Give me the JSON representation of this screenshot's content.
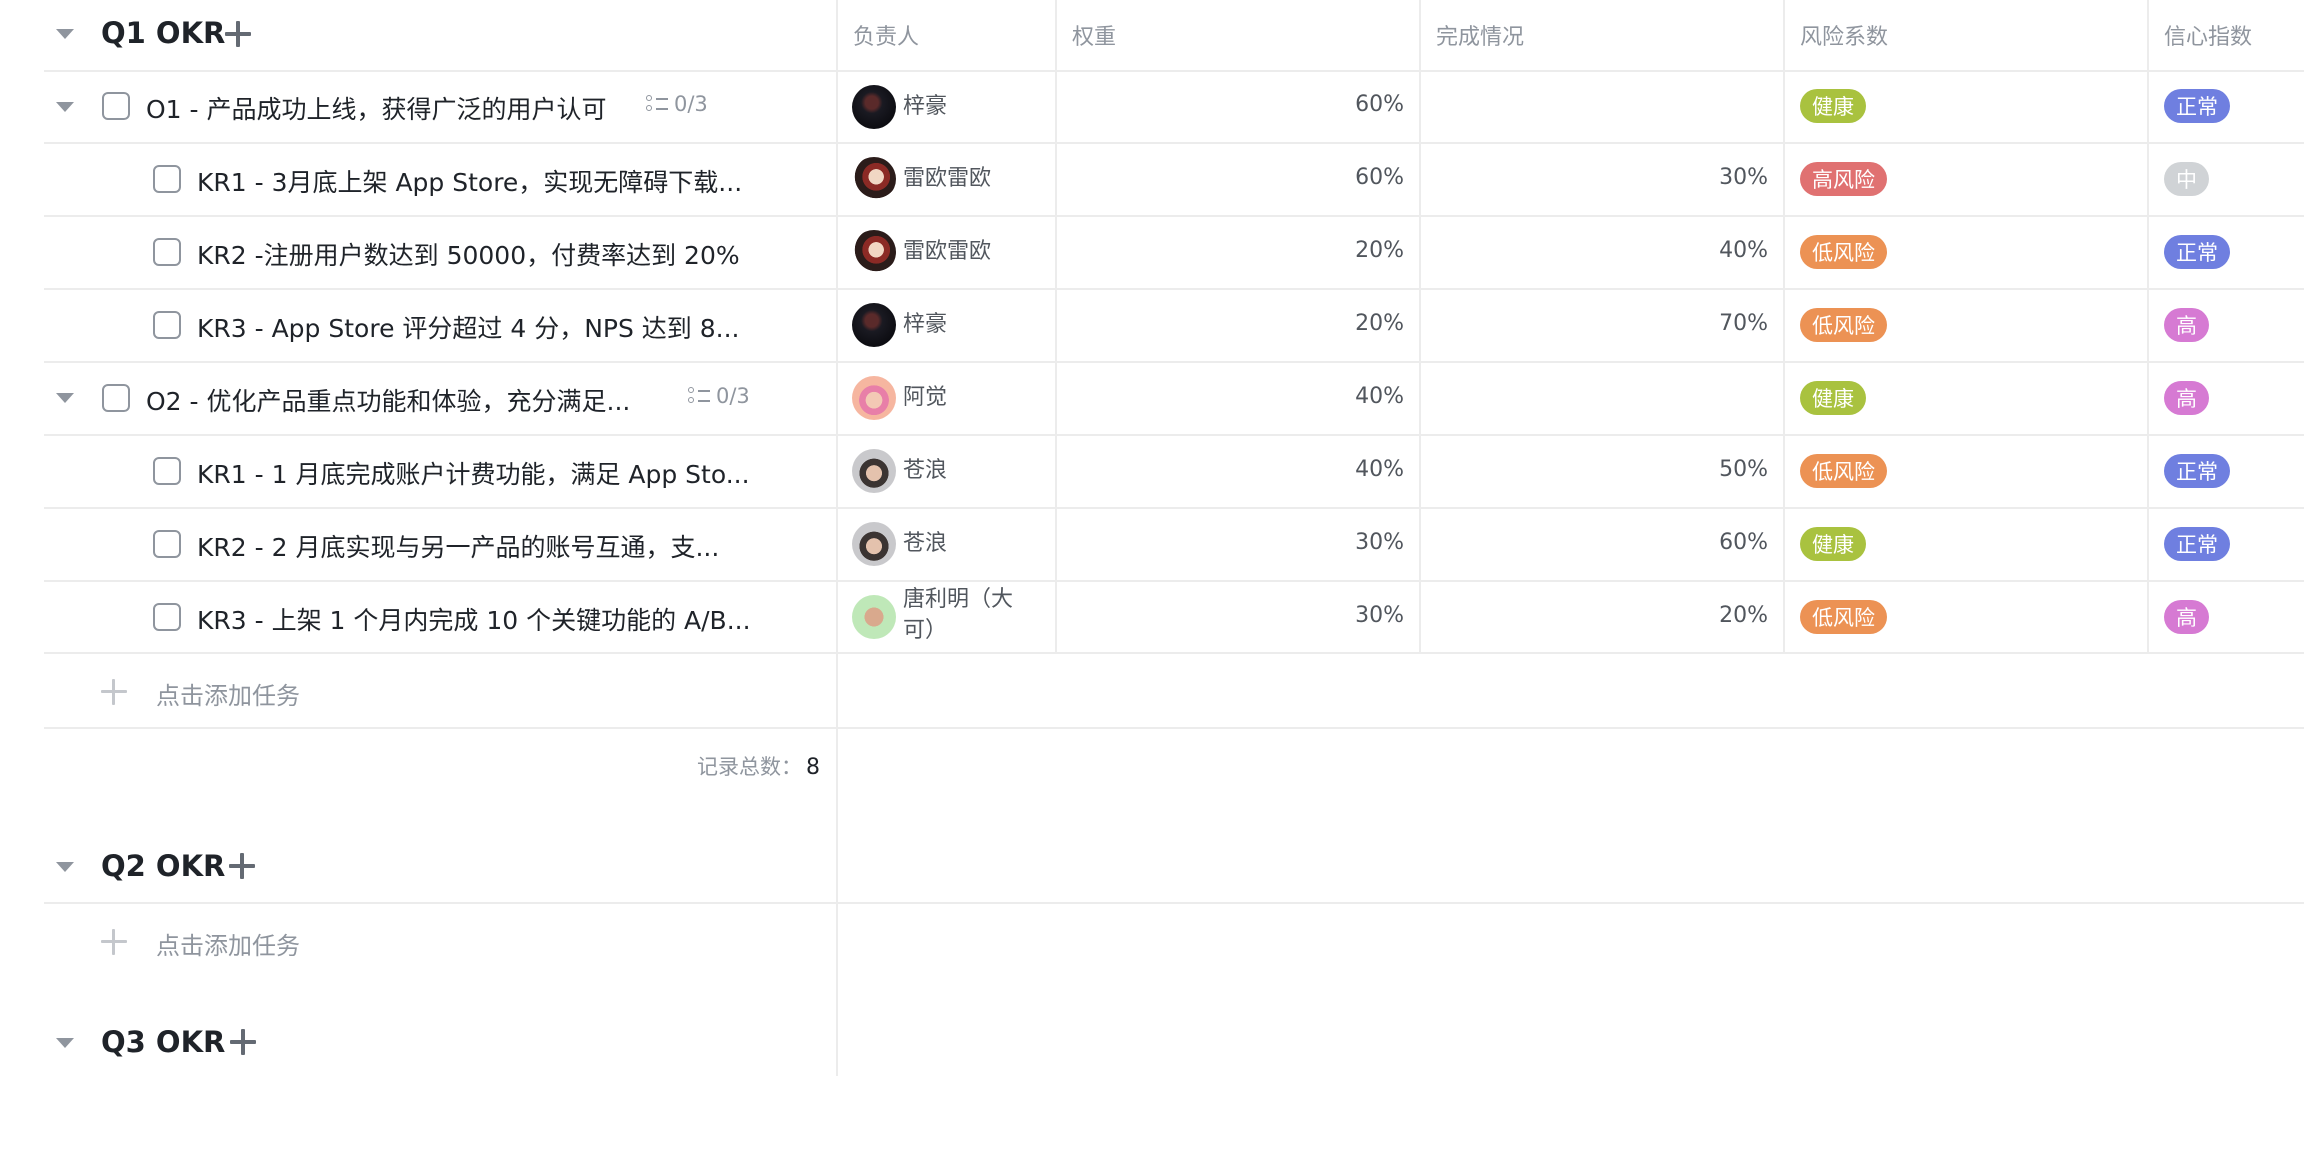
{
  "columns": {
    "owner": "负责人",
    "weight": "权重",
    "progress": "完成情况",
    "risk": "风险系数",
    "confidence": "信心指数"
  },
  "groups": [
    {
      "title": "Q1 OKR"
    },
    {
      "title": "Q2 OKR"
    },
    {
      "title": "Q3 OKR"
    }
  ],
  "rows": [
    {
      "title": "O1 - 产品成功上线，获得广泛的用户认可",
      "subtasks": "0/3",
      "owner": "梓豪",
      "weight": "60%",
      "progress": "",
      "risk": "健康",
      "confidence": "正常"
    },
    {
      "title": "KR1 - 3月底上架 App Store，实现无障碍下载...",
      "owner": "雷欧雷欧",
      "weight": "60%",
      "progress": "30%",
      "risk": "高风险",
      "confidence": "中"
    },
    {
      "title": "KR2 -注册用户数达到 50000，付费率达到 20%",
      "owner": "雷欧雷欧",
      "weight": "20%",
      "progress": "40%",
      "risk": "低风险",
      "confidence": "正常"
    },
    {
      "title": "KR3 - App Store 评分超过 4 分，NPS 达到 8...",
      "owner": "梓豪",
      "weight": "20%",
      "progress": "70%",
      "risk": "低风险",
      "confidence": "高"
    },
    {
      "title": "O2 - 优化产品重点功能和体验，充分满足...",
      "subtasks": "0/3",
      "owner": "阿觉",
      "weight": "40%",
      "progress": "",
      "risk": "健康",
      "confidence": "高"
    },
    {
      "title": "KR1 - 1 月底完成账户计费功能，满足 App Sto...",
      "owner": "苍浪",
      "weight": "40%",
      "progress": "50%",
      "risk": "低风险",
      "confidence": "正常"
    },
    {
      "title": "KR2 - 2 月底实现与另一产品的账号互通，支...",
      "owner": "苍浪",
      "weight": "30%",
      "progress": "60%",
      "risk": "健康",
      "confidence": "正常"
    },
    {
      "title": "KR3 - 上架 1 个月内完成 10 个关键功能的 A/B...",
      "owner_line1": "唐利明（大",
      "owner_line2": "可）",
      "weight": "30%",
      "progress": "20%",
      "risk": "低风险",
      "confidence": "高"
    }
  ],
  "add_task_label": "点击添加任务",
  "record_total_label": "记录总数：",
  "record_total_value": "8",
  "tag_colors": {
    "健康": "#a9c23f",
    "高风险": "#e07171",
    "低风险": "#ec9254",
    "正常": "#6f7fe0",
    "中": "#d0d3d6",
    "高": "#d67ad3"
  },
  "icons": [
    "collapse-caret-icon",
    "plus-icon",
    "subtask-list-icon",
    "checkbox-icon"
  ]
}
